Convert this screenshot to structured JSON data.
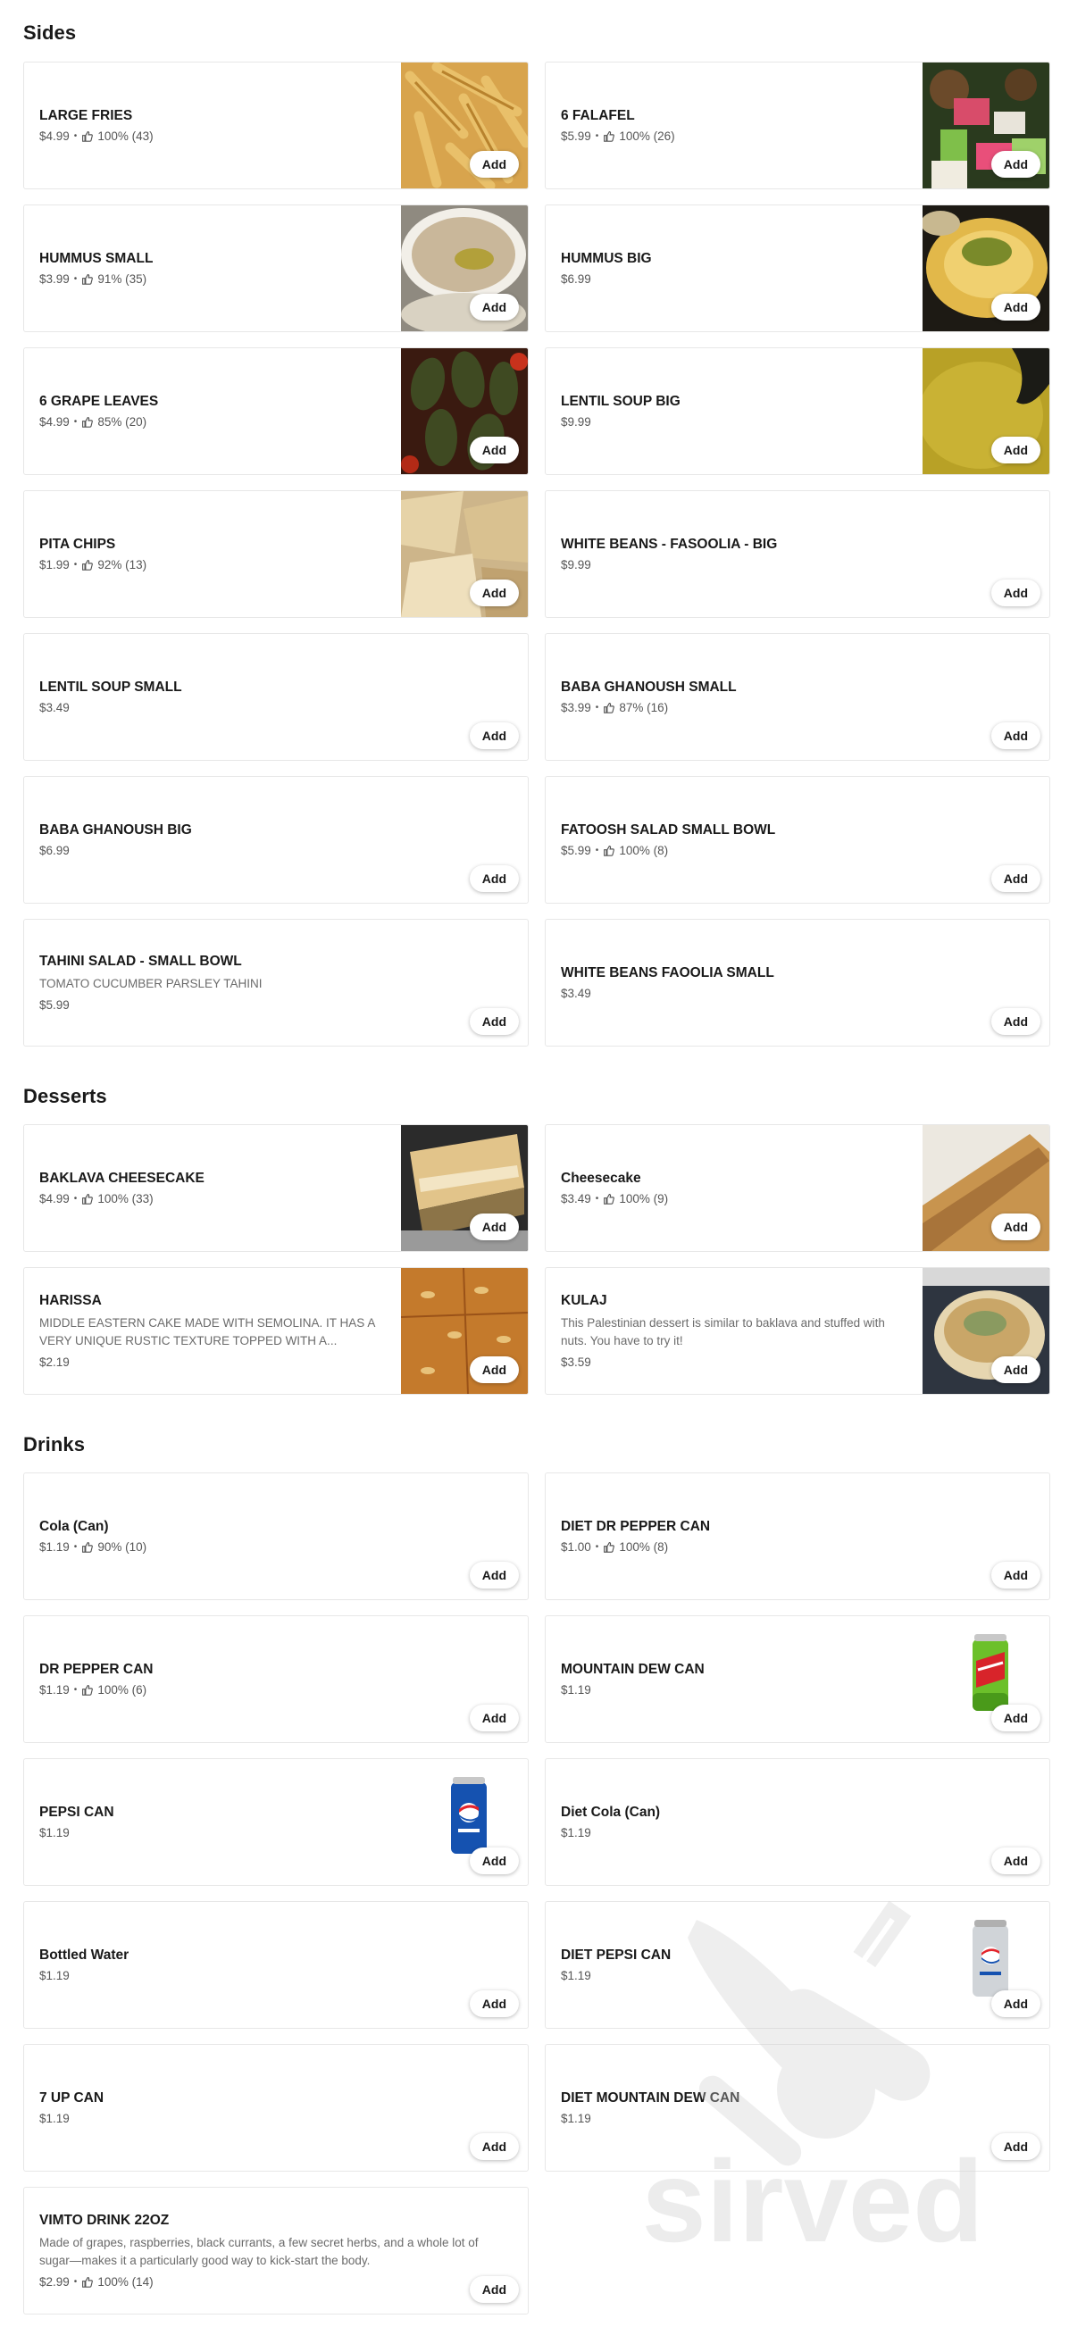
{
  "sections": {
    "sides": {
      "title": "Sides",
      "items": [
        {
          "name": "LARGE FRIES",
          "price": "$4.99",
          "rating": "100% (43)"
        },
        {
          "name": "6 FALAFEL",
          "price": "$5.99",
          "rating": "100% (26)"
        },
        {
          "name": "HUMMUS SMALL",
          "price": "$3.99",
          "rating": "91% (35)"
        },
        {
          "name": "HUMMUS BIG",
          "price": "$6.99"
        },
        {
          "name": "6 GRAPE LEAVES",
          "price": "$4.99",
          "rating": "85% (20)"
        },
        {
          "name": "LENTIL SOUP BIG",
          "price": "$9.99"
        },
        {
          "name": "PITA CHIPS",
          "price": "$1.99",
          "rating": "92% (13)"
        },
        {
          "name": "WHITE BEANS - FASOOLIA - BIG",
          "price": "$9.99"
        },
        {
          "name": "LENTIL SOUP SMALL",
          "price": "$3.49"
        },
        {
          "name": "BABA GHANOUSH SMALL",
          "price": "$3.99",
          "rating": "87% (16)"
        },
        {
          "name": "BABA GHANOUSH BIG",
          "price": "$6.99"
        },
        {
          "name": "FATOOSH SALAD SMALL BOWL",
          "price": "$5.99",
          "rating": "100% (8)"
        },
        {
          "name": "TAHINI SALAD - SMALL BOWL",
          "desc": "TOMATO CUCUMBER PARSLEY TAHINI",
          "price": "$5.99"
        },
        {
          "name": "WHITE BEANS FAOOLIA SMALL",
          "price": "$3.49"
        }
      ]
    },
    "desserts": {
      "title": "Desserts",
      "items": [
        {
          "name": "BAKLAVA CHEESECAKE",
          "price": "$4.99",
          "rating": "100% (33)"
        },
        {
          "name": "Cheesecake",
          "price": "$3.49",
          "rating": "100% (9)"
        },
        {
          "name": "HARISSA",
          "desc": "MIDDLE EASTERN CAKE MADE WITH SEMOLINA. IT HAS A VERY UNIQUE RUSTIC TEXTURE TOPPED WITH A...",
          "price": "$2.19"
        },
        {
          "name": "KULAJ",
          "desc": "This Palestinian dessert is similar to baklava and stuffed with nuts. You have to try it!",
          "price": "$3.59"
        }
      ]
    },
    "drinks": {
      "title": "Drinks",
      "items": [
        {
          "name": "Cola (Can)",
          "price": "$1.19",
          "rating": "90% (10)"
        },
        {
          "name": "DIET DR PEPPER CAN",
          "price": "$1.00",
          "rating": "100% (8)"
        },
        {
          "name": "DR PEPPER CAN",
          "price": "$1.19",
          "rating": "100% (6)"
        },
        {
          "name": "MOUNTAIN DEW CAN",
          "price": "$1.19"
        },
        {
          "name": "PEPSI CAN",
          "price": "$1.19"
        },
        {
          "name": "Diet Cola (Can)",
          "price": "$1.19"
        },
        {
          "name": "Bottled Water",
          "price": "$1.19"
        },
        {
          "name": "DIET PEPSI CAN",
          "price": "$1.19"
        },
        {
          "name": "7 UP CAN",
          "price": "$1.19"
        },
        {
          "name": "DIET MOUNTAIN DEW CAN",
          "price": "$1.19"
        },
        {
          "name": "VIMTO DRINK 22OZ",
          "desc": "Made of grapes, raspberries, black currants, a few secret herbs, and a whole lot of sugar—makes it a particularly good way to kick-start the body.",
          "price": "$2.99",
          "rating": "100% (14)"
        }
      ]
    }
  },
  "add_label": "Add",
  "watermark_text": "sirved",
  "colors": {
    "accent_button_bg": "#ffffff",
    "text": "#191919",
    "muted": "#6b6b6b",
    "border": "#e7e7e7"
  }
}
